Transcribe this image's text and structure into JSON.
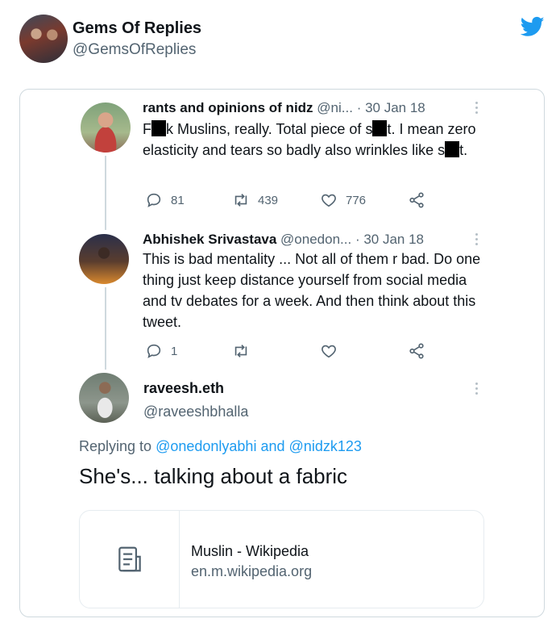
{
  "outer": {
    "name": "Gems Of Replies",
    "handle": "@GemsOfReplies",
    "bird_color": "#1d9bf0"
  },
  "tweets": [
    {
      "name": "rants and opinions of nidz",
      "handle": "@ni...",
      "date": "· 30 Jan 18",
      "text_parts": [
        "F",
        "k Muslins, really. Total piece of s",
        "t. I mean zero elasticity and tears so badly also wrinkles like s",
        "t."
      ],
      "replies": "81",
      "retweets": "439",
      "likes": "776"
    },
    {
      "name": "Abhishek Srivastava",
      "handle": "@onedon...",
      "date": "· 30 Jan 18",
      "text": "This is bad mentality ... Not all of them r bad. Do one thing just keep distance yourself from social media and tv debates for a week. And then think about this tweet.",
      "replies": "1"
    }
  ],
  "reply": {
    "name": "raveesh.eth",
    "handle": "@raveeshbhalla",
    "replying_prefix": "Replying to",
    "replying_user1": "@onedonlyabhi",
    "replying_and": "and",
    "replying_user2": "@nidzk123",
    "text": "She's... talking about a fabric",
    "link_title": "Muslin - Wikipedia",
    "link_domain": "en.m.wikipedia.org"
  },
  "colors": {
    "accent": "#1d9bf0",
    "secondary_text": "#536471",
    "border": "#cfd9de"
  }
}
